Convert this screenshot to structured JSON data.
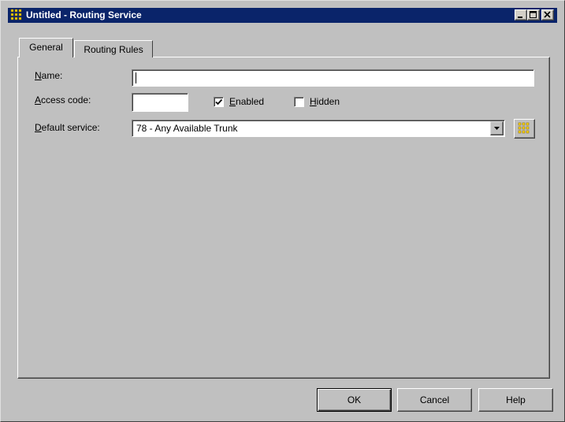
{
  "window": {
    "title": "Untitled - Routing Service",
    "title_icon": "grid-icon",
    "controls": [
      "minimize-icon",
      "maximize-icon",
      "close-icon"
    ]
  },
  "tabs": [
    {
      "label": "General",
      "selected": true
    },
    {
      "label": "Routing Rules",
      "selected": false
    }
  ],
  "form": {
    "name": {
      "label": "Name:",
      "accel": "N",
      "rest": "ame:",
      "value": ""
    },
    "access_code": {
      "label": "Access code:",
      "accel": "A",
      "rest": "ccess code:",
      "value": ""
    },
    "enabled": {
      "label": "Enabled",
      "accel": "E",
      "rest": "nabled",
      "checked": true
    },
    "hidden": {
      "label": "Hidden",
      "accel": "H",
      "rest": "idden",
      "checked": false
    },
    "default_service": {
      "label": "Default service:",
      "accel": "D",
      "rest": "efault service:",
      "value": "78 - Any Available Trunk",
      "browse_icon": "grid-icon"
    }
  },
  "buttons": {
    "ok": "OK",
    "cancel": "Cancel",
    "help": "Help"
  },
  "colors": {
    "titlebar": "#0a246a",
    "face": "#c0c0c0",
    "grid_icon_yellow": "#ffd800"
  }
}
